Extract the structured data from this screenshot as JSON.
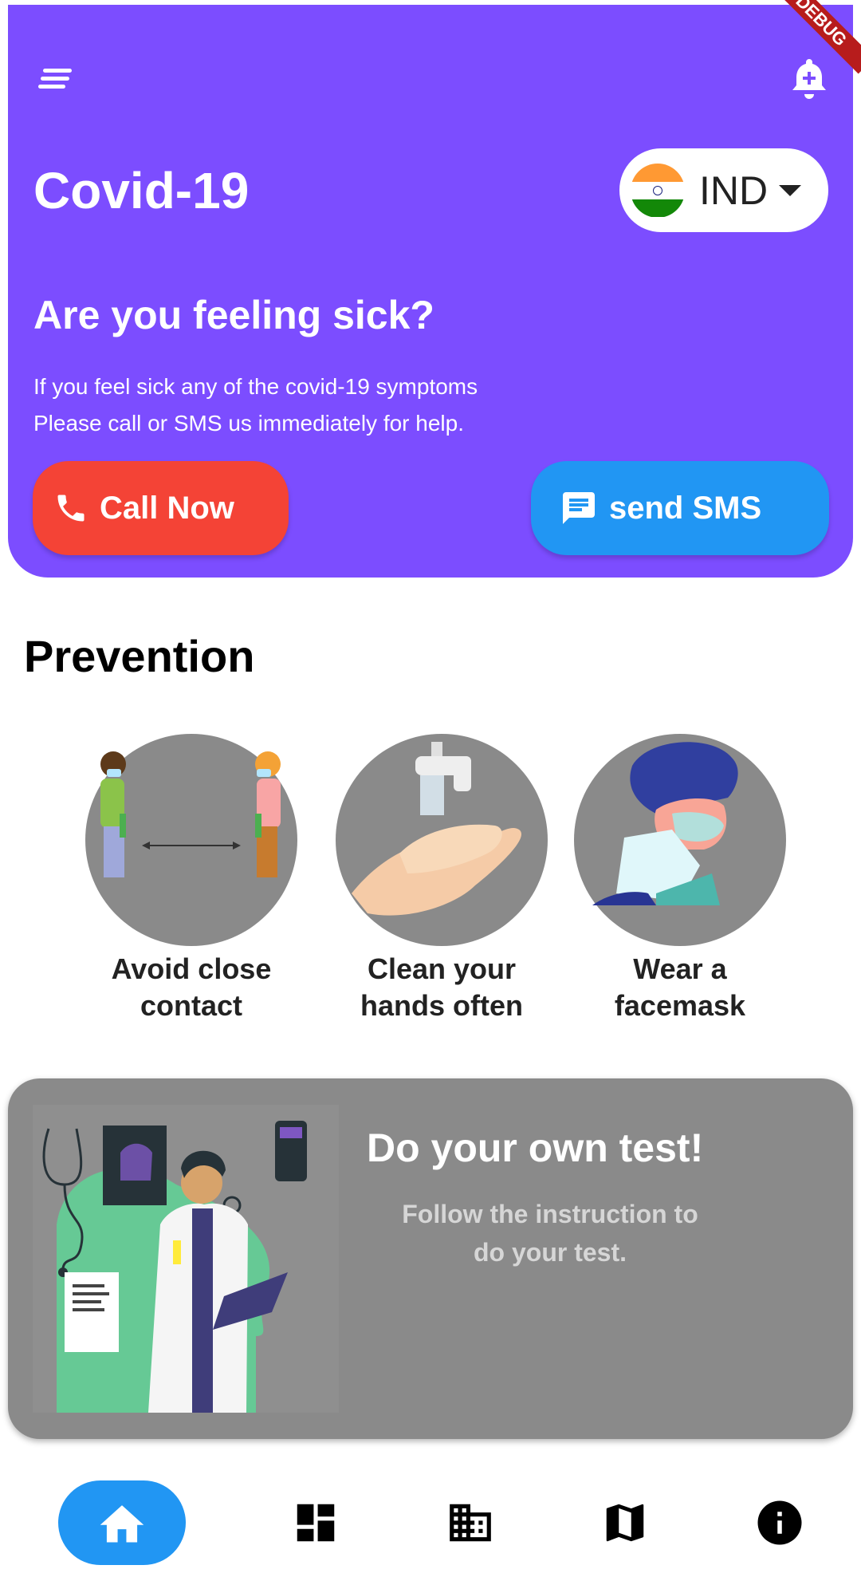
{
  "header": {
    "title": "Covid-19",
    "country": {
      "code": "IND",
      "flag": "india-flag"
    },
    "question": "Are you feeling sick?",
    "description_lines": [
      "If you feel sick any of the covid-19 symptoms",
      "Please call or SMS us immediately for help."
    ],
    "call_label": "Call Now",
    "sms_label": "send SMS",
    "debug_banner": "DEBUG"
  },
  "prevention": {
    "title": "Prevention",
    "items": [
      {
        "label_lines": [
          "Avoid close",
          "contact"
        ],
        "icon": "social-distance-illustration"
      },
      {
        "label_lines": [
          "Clean your",
          "hands often"
        ],
        "icon": "handwash-illustration"
      },
      {
        "label_lines": [
          "Wear a",
          "facemask"
        ],
        "icon": "facemask-illustration"
      }
    ]
  },
  "test_card": {
    "title": "Do your own test!",
    "description_lines": [
      "Follow the instruction to",
      "do your test."
    ]
  },
  "nav": {
    "items": [
      "home-icon",
      "dashboard-icon",
      "building-icon",
      "map-icon",
      "info-icon"
    ],
    "active": "home-icon"
  },
  "colors": {
    "header_bg": "#7c4dff",
    "call_button": "#f44336",
    "sms_button": "#2196f3",
    "nav_active": "#2196f3",
    "card_bg": "#8a8a8a"
  }
}
